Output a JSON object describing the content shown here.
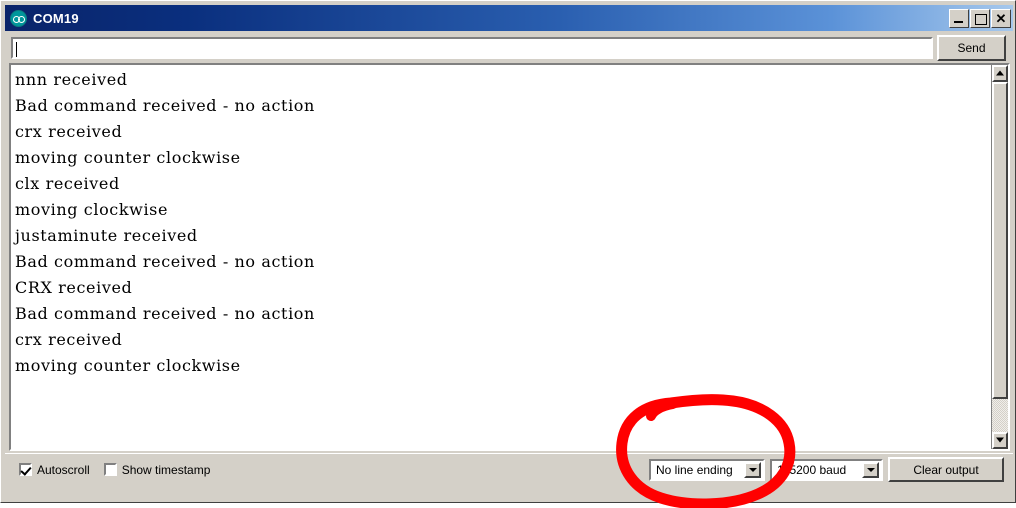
{
  "window": {
    "title": "COM19",
    "icon": "arduino-infinity-icon",
    "controls": {
      "minimize": "_",
      "maximize": "□",
      "close": "✕"
    }
  },
  "send_row": {
    "input_value": "",
    "input_placeholder": "",
    "send_label": "Send"
  },
  "console": {
    "lines": [
      "nnn received",
      "Bad command received - no action",
      "crx received",
      "moving counter clockwise",
      "clx received",
      "moving clockwise",
      "justaminute received",
      "Bad command received - no action",
      "CRX received",
      "Bad command received - no action",
      "crx received",
      "moving counter clockwise"
    ]
  },
  "scrollbar": {
    "up_arrow": "▲",
    "down_arrow": "▼"
  },
  "statusbar": {
    "autoscroll_label": "Autoscroll",
    "autoscroll_checked": true,
    "timestamp_label": "Show timestamp",
    "timestamp_checked": false,
    "line_ending_value": "No line ending",
    "baud_value": "115200 baud",
    "clear_label": "Clear output"
  },
  "annotation": {
    "shape": "hand-drawn-ellipse",
    "color": "#FF0000",
    "target": "line-ending-dropdown"
  },
  "colors": {
    "titlebar_start": "#0a246a",
    "titlebar_end": "#a6c8ec",
    "chrome": "#d4d0c8",
    "console_bg": "#ffffff",
    "console_text": "#000000",
    "annotation_red": "#FF0000",
    "arduino_teal": "#00979c"
  }
}
